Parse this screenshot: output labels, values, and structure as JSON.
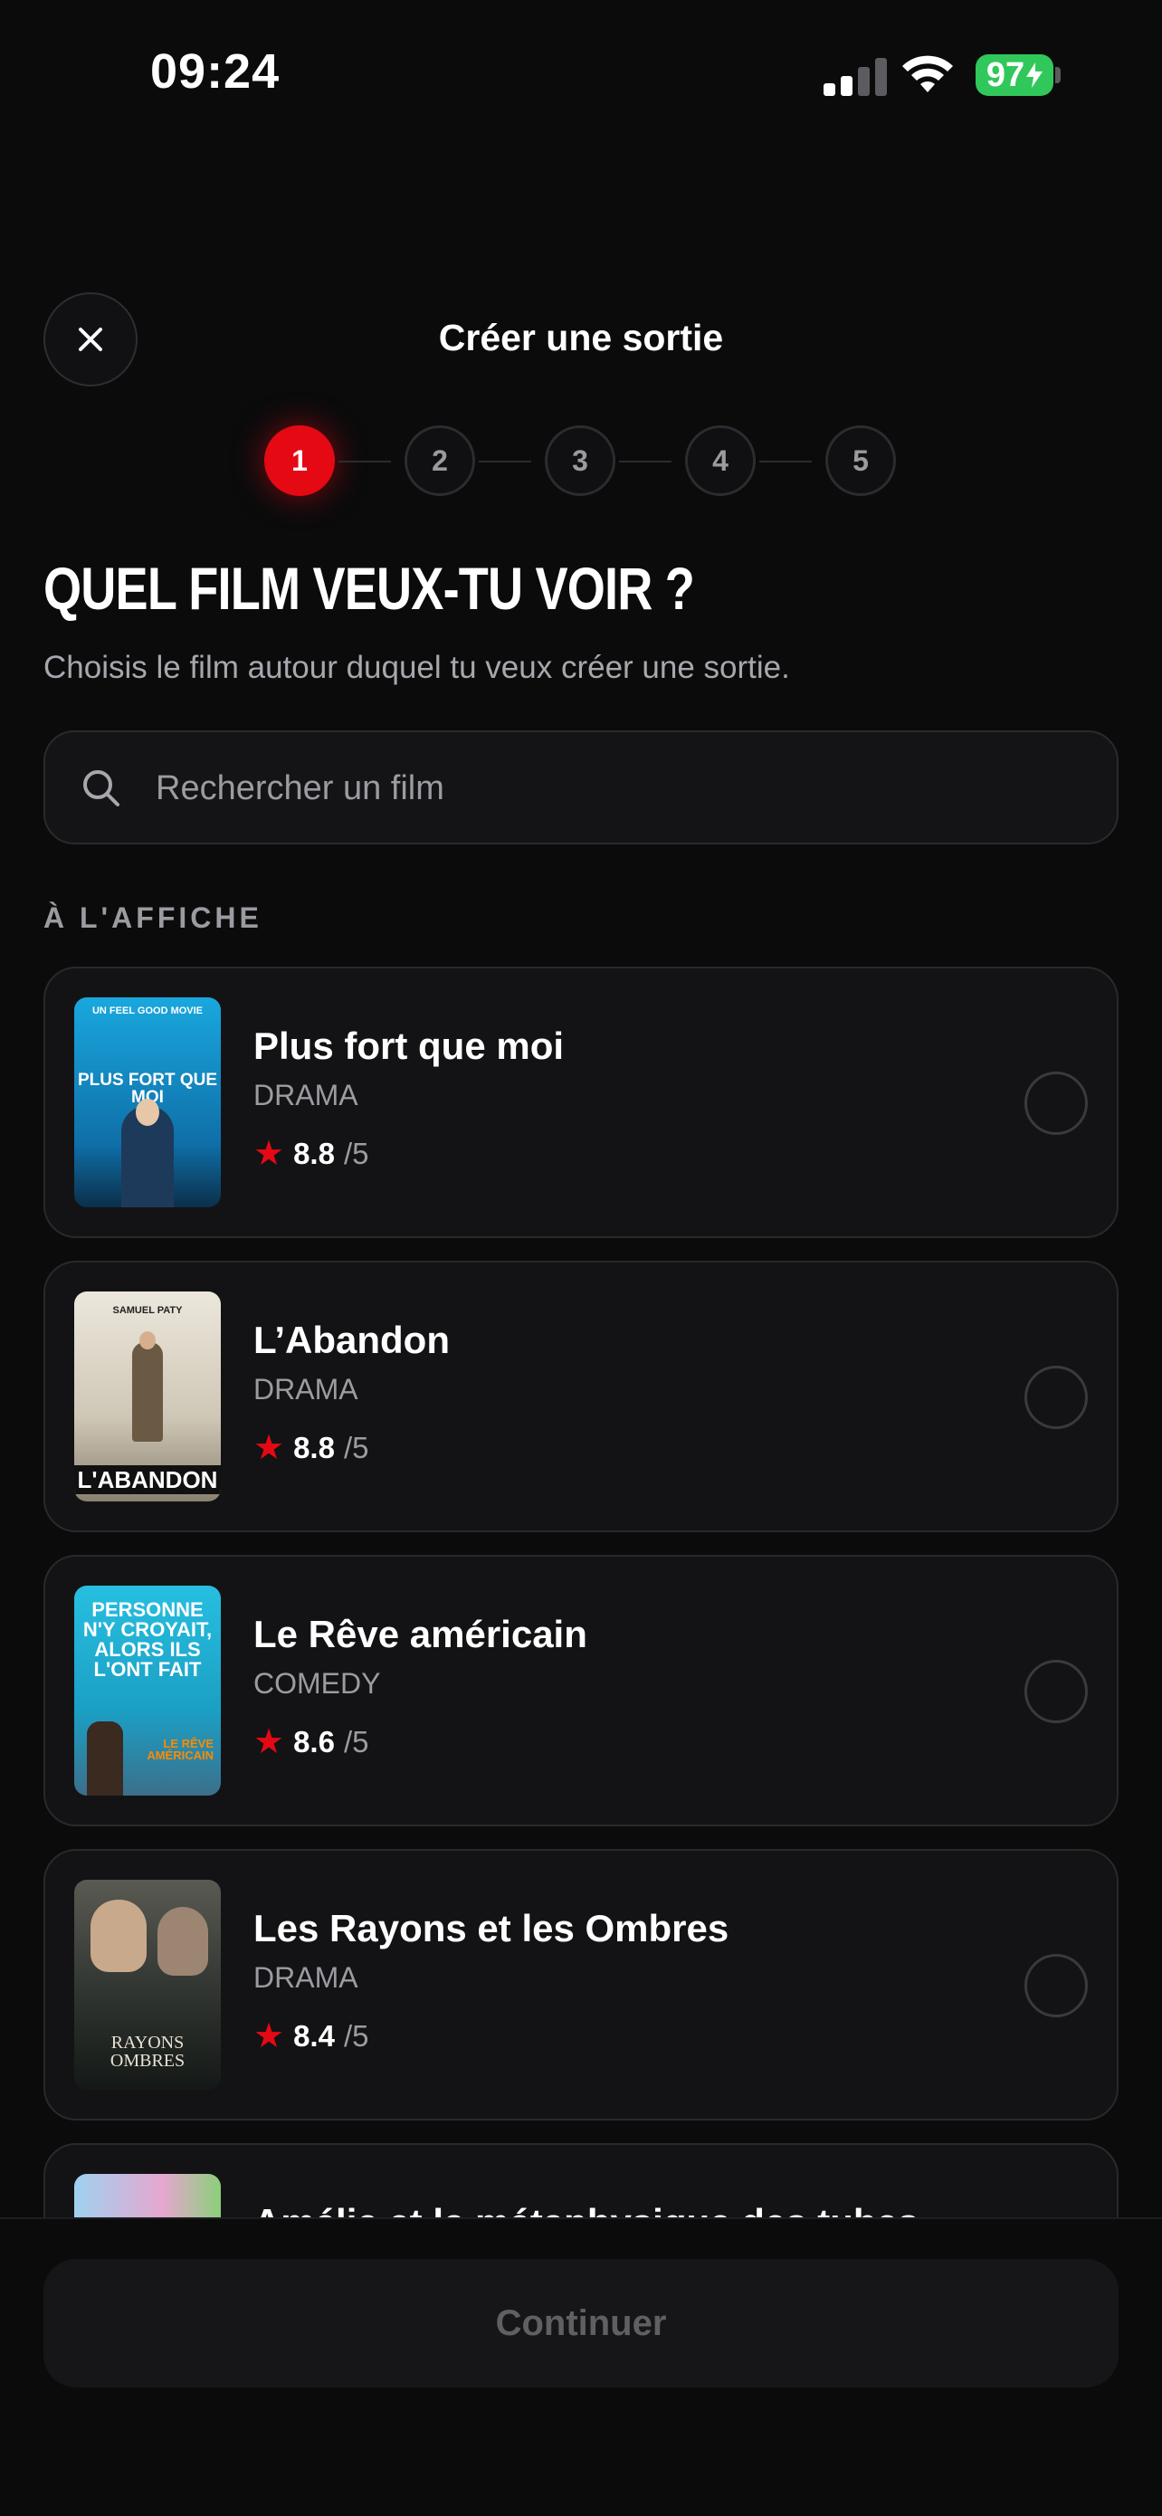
{
  "status_bar": {
    "time": "09:24",
    "battery": "97"
  },
  "header": {
    "title": "Créer une sortie"
  },
  "stepper": {
    "steps": [
      "1",
      "2",
      "3",
      "4",
      "5"
    ],
    "active": 1
  },
  "page": {
    "title": "QUEL FILM VEUX-TU VOIR ?",
    "subtitle": "Choisis le film autour duquel tu veux créer une sortie."
  },
  "search": {
    "placeholder": "Rechercher un film",
    "value": ""
  },
  "section": {
    "label": "À L'AFFICHE"
  },
  "movies": [
    {
      "title": "Plus fort que moi",
      "genre": "DRAMA",
      "rating": "8.8",
      "max": "/5",
      "poster_color": "#1aa6d9"
    },
    {
      "title": "L’Abandon",
      "genre": "DRAMA",
      "rating": "8.8",
      "max": "/5",
      "poster_color": "#d9d3c6"
    },
    {
      "title": "Le Rêve américain",
      "genre": "COMEDY",
      "rating": "8.6",
      "max": "/5",
      "poster_color": "#22b3d1"
    },
    {
      "title": "Les Rayons et les Ombres",
      "genre": "DRAMA",
      "rating": "8.4",
      "max": "/5",
      "poster_color": "#3a3f38"
    },
    {
      "title": "Amélie et la métaphysique des tubes",
      "genre": "",
      "rating": "",
      "max": "",
      "poster_color": "#8fc1e6"
    }
  ],
  "posters": {
    "p1_line1": "UN FEEL GOOD MOVIE",
    "p1_title": "PLUS FORT QUE MOI",
    "p2_top": "SAMUEL PATY",
    "p2_title": "L'ABANDON",
    "p3_title": "PERSONNE N'Y CROYAIT, ALORS ILS L'ONT FAIT",
    "p3_sub": "LE RÊVE AMÉRICAIN",
    "p4_title": "RAYONS OMBRES"
  },
  "footer": {
    "continue_label": "Continuer"
  },
  "colors": {
    "accent": "#e50914",
    "background": "#0b0b0c",
    "card": "#131315"
  }
}
